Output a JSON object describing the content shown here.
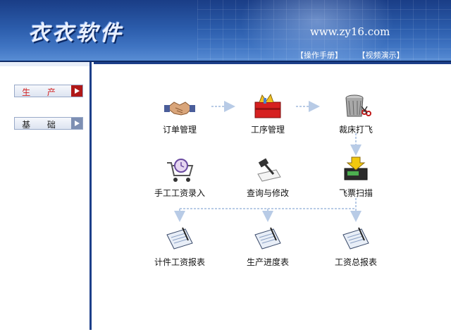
{
  "header": {
    "brand": "衣衣软件",
    "url": "www.zy16.com",
    "link_manual": "【操作手册】",
    "link_video": "【视频演示】"
  },
  "sidebar": {
    "production": "生 产",
    "base": "基 础"
  },
  "nodes": {
    "order": "订单管理",
    "process": "工序管理",
    "cutting": "裁床打飞",
    "manual_wage": "手工工资录入",
    "query_edit": "查询与修改",
    "ticket_scan": "飞票扫描",
    "piece_wage": "计件工资报表",
    "progress": "生产进度表",
    "total_wage": "工资总报表"
  },
  "colors": {
    "header_dark": "#1a3d86",
    "border_blue": "#1d3f8a",
    "active_red": "#d02020",
    "arrow_light": "#b8cbe6"
  }
}
